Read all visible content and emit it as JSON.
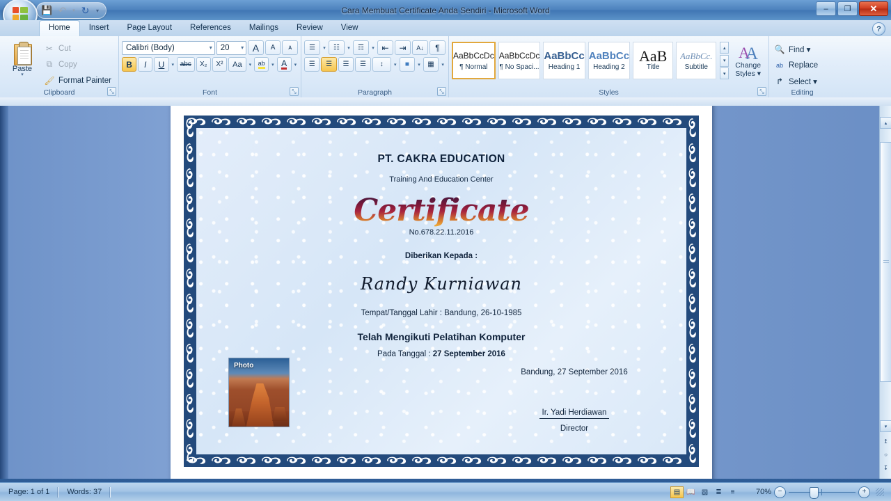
{
  "window": {
    "title": "Cara Membuat Certificate Anda Sendiri - Microsoft Word",
    "minimize": "–",
    "maximize": "❐",
    "close": "✕"
  },
  "quick_access": {
    "save": "💾",
    "undo": "↶",
    "undo_caret": "▾",
    "redo": "↻",
    "customize": "▾"
  },
  "help_button": "?",
  "tabs": [
    {
      "label": "Home",
      "active": true
    },
    {
      "label": "Insert",
      "active": false
    },
    {
      "label": "Page Layout",
      "active": false
    },
    {
      "label": "References",
      "active": false
    },
    {
      "label": "Mailings",
      "active": false
    },
    {
      "label": "Review",
      "active": false
    },
    {
      "label": "View",
      "active": false
    }
  ],
  "ribbon": {
    "clipboard": {
      "group_label": "Clipboard",
      "paste_label": "Paste",
      "paste_caret": "▾",
      "cut_label": "Cut",
      "cut_icon": "✂",
      "copy_label": "Copy",
      "copy_icon": "⧉",
      "format_painter_label": "Format Painter",
      "format_painter_icon": "🖌",
      "launcher": "⤡"
    },
    "font": {
      "group_label": "Font",
      "font_name": "Calibri (Body)",
      "font_size": "20",
      "caret": "▾",
      "grow_font": "A",
      "shrink_font": "A",
      "clear_formatting": "ᴀ",
      "bold": "B",
      "italic": "I",
      "underline": "U",
      "strikethrough": "abc",
      "subscript": "X₂",
      "superscript": "X²",
      "change_case": "Aa",
      "highlight": "ab",
      "font_color": "A",
      "launcher": "⤡"
    },
    "paragraph": {
      "group_label": "Paragraph",
      "bullets": "☰",
      "numbering": "☷",
      "multilevel": "☶",
      "decrease_indent": "⇤",
      "increase_indent": "⇥",
      "sort": "A↓",
      "show_marks": "¶",
      "align_left": "☰",
      "align_center": "☰",
      "align_right": "☰",
      "justify": "☰",
      "line_spacing": "↕",
      "shading": "■",
      "borders": "▦",
      "caret": "▾",
      "launcher": "⤡"
    },
    "styles": {
      "group_label": "Styles",
      "items": [
        {
          "sample": "AaBbCcDc",
          "name": "¶ Normal",
          "selected": true
        },
        {
          "sample": "AaBbCcDc",
          "name": "¶ No Spaci...",
          "selected": false
        },
        {
          "sample": "AaBbCс",
          "name": "Heading 1",
          "selected": false
        },
        {
          "sample": "AaBbCc",
          "name": "Heading 2",
          "selected": false
        },
        {
          "sample": "AaB",
          "name": "Title",
          "selected": false
        },
        {
          "sample": "AaBbCc.",
          "name": "Subtitle",
          "selected": false
        }
      ],
      "scroll_up": "▴",
      "scroll_down": "▾",
      "more": "▾",
      "change_styles_label": "Change",
      "change_styles_label2": "Styles ▾",
      "launcher": "⤡"
    },
    "editing": {
      "group_label": "Editing",
      "find_label": "Find ▾",
      "find_icon": "🔍",
      "replace_label": "Replace",
      "replace_icon": "ab",
      "select_label": "Select ▾",
      "select_icon": "↱"
    }
  },
  "document": {
    "organization": "PT. CAKRA EDUCATION",
    "tagline": "Training And Education Center",
    "certificate_word": "Certificate",
    "certificate_number": "No.678.22.11.2016",
    "given_to_label": "Diberikan Kepada :",
    "recipient_name": "Randy Kurniawan",
    "birth_info": "Tempat/Tanggal Lahir : Bandung, 26-10-1985",
    "course_line": "Telah Mengikuti Pelatihan Komputer",
    "date_label": "Pada Tanggal : ",
    "date_value": "27 September 2016",
    "photo_label": "Photo",
    "signature_place_date": "Bandung, 27 September 2016",
    "signature_name": "Ir. Yadi Herdiawan",
    "signature_role": "Director"
  },
  "scrollbar": {
    "up_arrow": "▴",
    "down_arrow": "▾",
    "prev_page": "↥",
    "select_object": "○",
    "next_page": "↧"
  },
  "status_bar": {
    "page": "Page: 1 of 1",
    "words": "Words: 37",
    "zoom_level": "70%",
    "zoom_out": "−",
    "zoom_in": "+",
    "views": [
      {
        "icon": "▤",
        "name": "print-layout",
        "selected": true
      },
      {
        "icon": "📖",
        "name": "full-screen-reading",
        "selected": false
      },
      {
        "icon": "▧",
        "name": "web-layout",
        "selected": false
      },
      {
        "icon": "≣",
        "name": "outline",
        "selected": false
      },
      {
        "icon": "≡",
        "name": "draft",
        "selected": false
      }
    ]
  },
  "colors": {
    "title_bar": "#4d82bd",
    "ribbon": "#e3eefa",
    "workspace": "#7a9bd1",
    "cert_border": "#234a7c",
    "cert_paper": "#dde9f8",
    "accent_gold": "#f5c44c"
  }
}
